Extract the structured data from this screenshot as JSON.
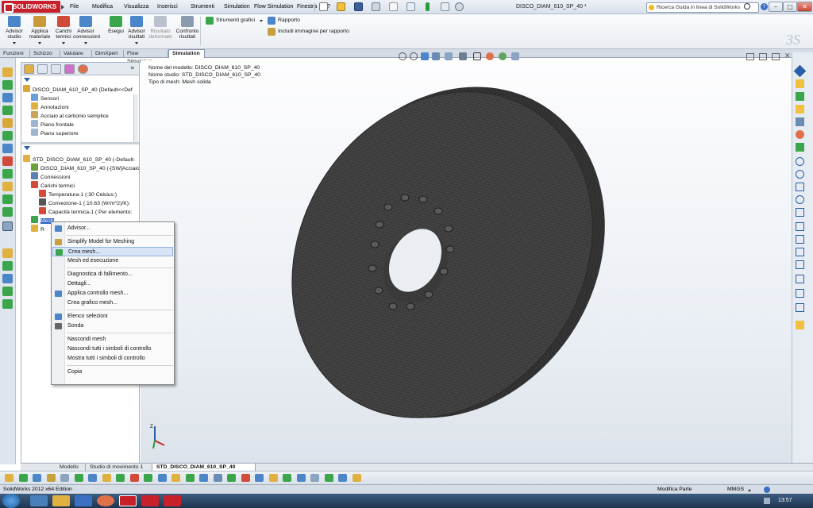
{
  "app": {
    "logo": "SOLIDWORKS",
    "document_title": "DISCO_DIAM_610_SP_40 *",
    "search_placeholder": "Ricerca Guida in linea di SolidWorks"
  },
  "menu": [
    "File",
    "Modifica",
    "Visualizza",
    "Inserisci",
    "Strumenti",
    "Simulation",
    "Flow Simulation",
    "Finestra",
    "?"
  ],
  "window_buttons": {
    "minimize": "–",
    "maximize": "□",
    "close": "✕"
  },
  "ribbon": {
    "buttons": [
      {
        "label1": "Advisor",
        "label2": "studio",
        "enabled": true,
        "color": "#4a86c8"
      },
      {
        "label1": "Applica",
        "label2": "materiale",
        "enabled": true,
        "color": "#c89a3a"
      },
      {
        "label1": "Carichi",
        "label2": "termici",
        "enabled": true,
        "color": "#d24a3a"
      },
      {
        "label1": "Advisor",
        "label2": "connessioni",
        "enabled": true,
        "color": "#4a86c8"
      },
      {
        "label1": "Esegui",
        "label2": "",
        "enabled": true,
        "color": "#3aa54a"
      },
      {
        "label1": "Advisor",
        "label2": "risultati",
        "enabled": true,
        "color": "#4a86c8"
      },
      {
        "label1": "Risultato",
        "label2": "deformato",
        "enabled": false,
        "color": "#b9c2cc"
      },
      {
        "label1": "Confronto",
        "label2": "risultati",
        "enabled": true,
        "color": "#8a9bb0"
      }
    ],
    "small": [
      "Strumenti grafici",
      "Rapporto",
      "Includi immagine per rapporto"
    ]
  },
  "command_tabs": [
    "Funzioni",
    "Schizzo",
    "Valutare",
    "DimXpert",
    "Flow Simulation",
    "Simulation"
  ],
  "active_command_tab": "Simulation",
  "feature_tree": [
    {
      "text": "DISCO_DIAM_610_SP_40  (Default<<Def",
      "icon": "#d9a63a",
      "indent": 0
    },
    {
      "text": "Sensori",
      "icon": "#6aa0d8",
      "indent": 1
    },
    {
      "text": "Annotazioni",
      "icon": "#e0b040",
      "indent": 1
    },
    {
      "text": "Acciaio al carbonio semplice",
      "icon": "#c9a25e",
      "indent": 1
    },
    {
      "text": "Piano frontale",
      "icon": "#9eb5cf",
      "indent": 1
    },
    {
      "text": "Piano superiore",
      "icon": "#9eb5cf",
      "indent": 1
    }
  ],
  "sim_tree": [
    {
      "text": "STD_DISCO_DIAM_610_SP_40 (-Default-",
      "icon": "#e0b040",
      "indent": 0,
      "selected": false
    },
    {
      "text": "DISCO_DIAM_610_SP_40 (-[SW]Acciaio",
      "icon": "#6aa23a",
      "indent": 1,
      "selected": false
    },
    {
      "text": "Connessioni",
      "icon": "#5a7fb0",
      "indent": 1,
      "selected": false
    },
    {
      "text": "Carichi termici",
      "icon": "#d24a3a",
      "indent": 1,
      "selected": false
    },
    {
      "text": "Temperatura-1 (:30 Celsius:)",
      "icon": "#d24a3a",
      "indent": 2,
      "selected": false
    },
    {
      "text": "Convezione-1 (:10.63 (W/m^2)/K):",
      "icon": "#555555",
      "indent": 2,
      "selected": false
    },
    {
      "text": "Capacità termica-1 (:Per elemento:",
      "icon": "#d24a3a",
      "indent": 2,
      "selected": false
    },
    {
      "text": "Mesh",
      "icon": "#3aa54a",
      "indent": 1,
      "selected": true
    },
    {
      "text": "R",
      "icon": "#e0b040",
      "indent": 1,
      "selected": false
    }
  ],
  "context_menu": [
    {
      "label": "Advisor...",
      "icon": "#4a86c8",
      "hl": false
    },
    {
      "sep": true
    },
    {
      "label": "Simplify Model for Meshing",
      "icon": "#c8a040",
      "hl": false
    },
    {
      "label": "Crea mesh...",
      "icon": "#3aa54a",
      "hl": true
    },
    {
      "label": "Mesh ed esecuzione",
      "icon": "",
      "hl": false
    },
    {
      "sep": true
    },
    {
      "label": "Diagnostica di fallimento...",
      "icon": "",
      "hl": false
    },
    {
      "label": "Dettagli...",
      "icon": "",
      "hl": false
    },
    {
      "label": "Applica controllo mesh...",
      "icon": "#4a86c8",
      "hl": false
    },
    {
      "label": "Crea grafico mesh...",
      "icon": "",
      "hl": false
    },
    {
      "sep": true
    },
    {
      "label": "Elenco selezioni",
      "icon": "#4a86c8",
      "hl": false
    },
    {
      "label": "Sonda",
      "icon": "#666666",
      "hl": false
    },
    {
      "sep": true
    },
    {
      "label": "Nascondi mesh",
      "icon": "",
      "hl": false
    },
    {
      "label": "Nascondi tutti i simboli di controllo",
      "icon": "",
      "hl": false
    },
    {
      "label": "Mostra tutti i simboli di controllo",
      "icon": "",
      "hl": false
    },
    {
      "sep": true
    },
    {
      "label": "Copia",
      "icon": "",
      "hl": false
    }
  ],
  "viewport_info": [
    "Nome del modello: DISCO_DIAM_610_SP_40",
    "Nome studio: STD_DISCO_DIAM_610_SP_40",
    "Tipo di mesh: Mesh solida"
  ],
  "bottom_tabs": [
    "Modello",
    "Studio di movimento 1",
    "STD_DISCO_DIAM_610_SP_40"
  ],
  "active_bottom_tab": "STD_DISCO_DIAM_610_SP_40",
  "status": {
    "left": "SolidWorks 2012 x64 Edition",
    "mode": "Modifica Parte",
    "units": "MMGS"
  },
  "clock": "13:57",
  "axes": {
    "z": "Z",
    "x": "X",
    "y": "Y"
  }
}
